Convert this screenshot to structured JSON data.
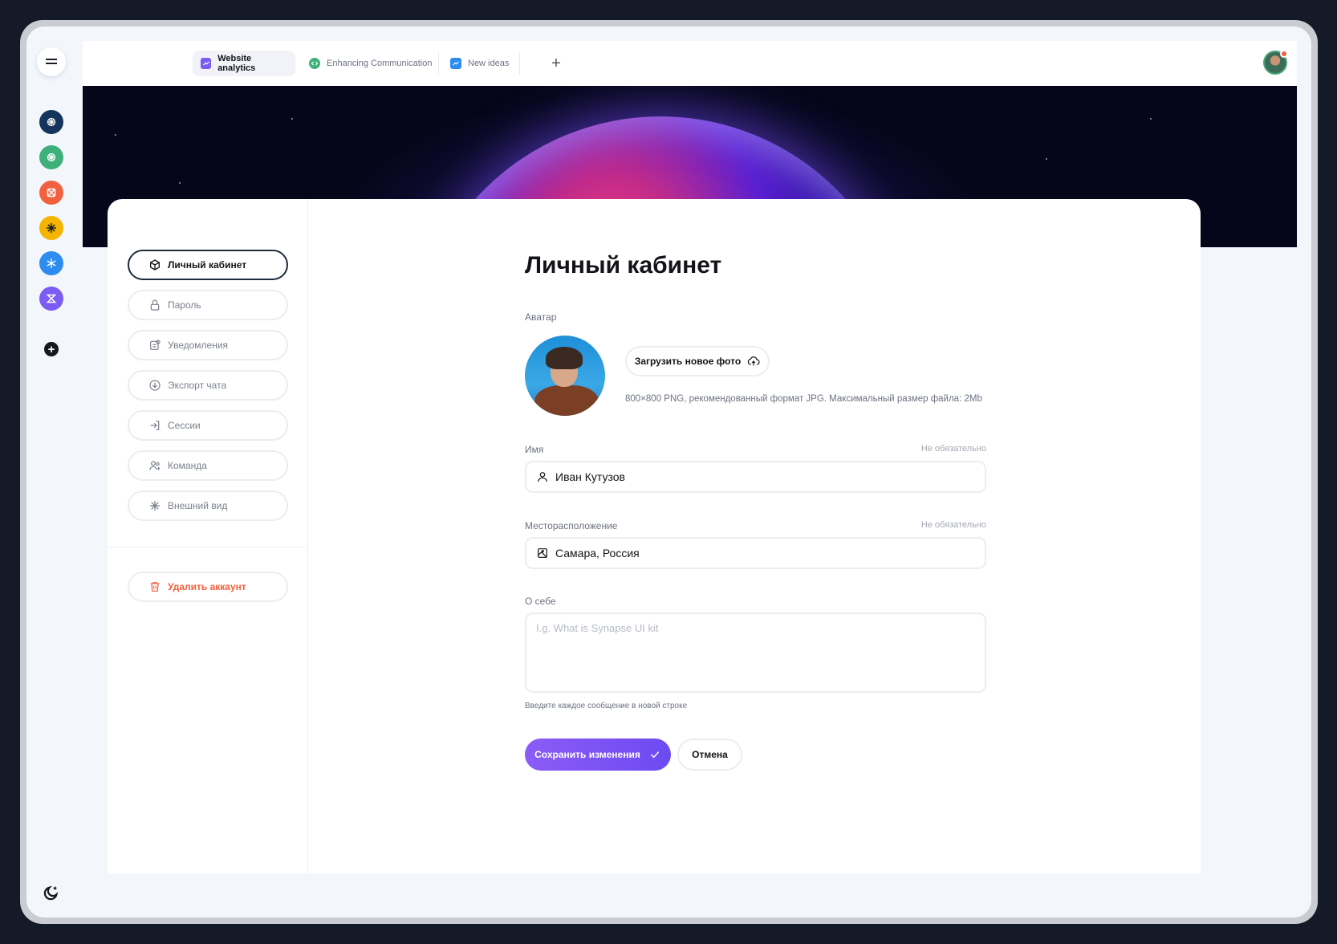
{
  "tabs": [
    {
      "label": "Website analytics",
      "icon": "chart-icon",
      "color": "#7c5cf2",
      "active": true
    },
    {
      "label": "Enhancing Communication",
      "icon": "code-icon",
      "color": "#3eb07a",
      "active": false
    },
    {
      "label": "New ideas",
      "icon": "chart-icon",
      "color": "#2d8cf0",
      "active": false
    }
  ],
  "rail": {
    "apps": [
      {
        "name": "openai-icon",
        "color": "#14345c"
      },
      {
        "name": "openai-green-icon",
        "color": "#3eb07a"
      },
      {
        "name": "orange-app-icon",
        "color": "#f2613f"
      },
      {
        "name": "yellow-asterisk-icon",
        "color": "#f4b400"
      },
      {
        "name": "blue-snowflake-icon",
        "color": "#2d8cf0"
      },
      {
        "name": "purple-app-icon",
        "color": "#7c5cf2"
      }
    ]
  },
  "nav": {
    "items": [
      {
        "label": "Личный кабинет",
        "icon": "cube-icon"
      },
      {
        "label": "Пароль",
        "icon": "lock-icon"
      },
      {
        "label": "Уведомления",
        "icon": "notification-icon"
      },
      {
        "label": "Экспорт чата",
        "icon": "download-icon"
      },
      {
        "label": "Сессии",
        "icon": "login-icon"
      },
      {
        "label": "Команда",
        "icon": "team-icon"
      },
      {
        "label": "Внешний вид",
        "icon": "asterisk-icon"
      }
    ],
    "delete_label": "Удалить аккаунт"
  },
  "form": {
    "title": "Личный кабинет",
    "avatar_label": "Аватар",
    "upload_label": "Загрузить новое фото",
    "avatar_hint": "800×800 PNG, рекомендованный формат JPG. Максимальный размер файла: 2Mb",
    "name_label": "Имя",
    "name_optional": "Не обязательно",
    "name_value": "Иван Кутузов",
    "location_label": "Месторасположение",
    "location_optional": "Не обязательно",
    "location_value": "Самара, Россия",
    "about_label": "О себе",
    "about_placeholder": "I.g. What is Synapse UI kit",
    "about_hint": "Введите каждое сообщение в новой строке",
    "save_label": "Сохранить изменения",
    "cancel_label": "Отмена"
  },
  "colors": {
    "accent": "#7c5cf2",
    "danger": "#f2613f"
  }
}
